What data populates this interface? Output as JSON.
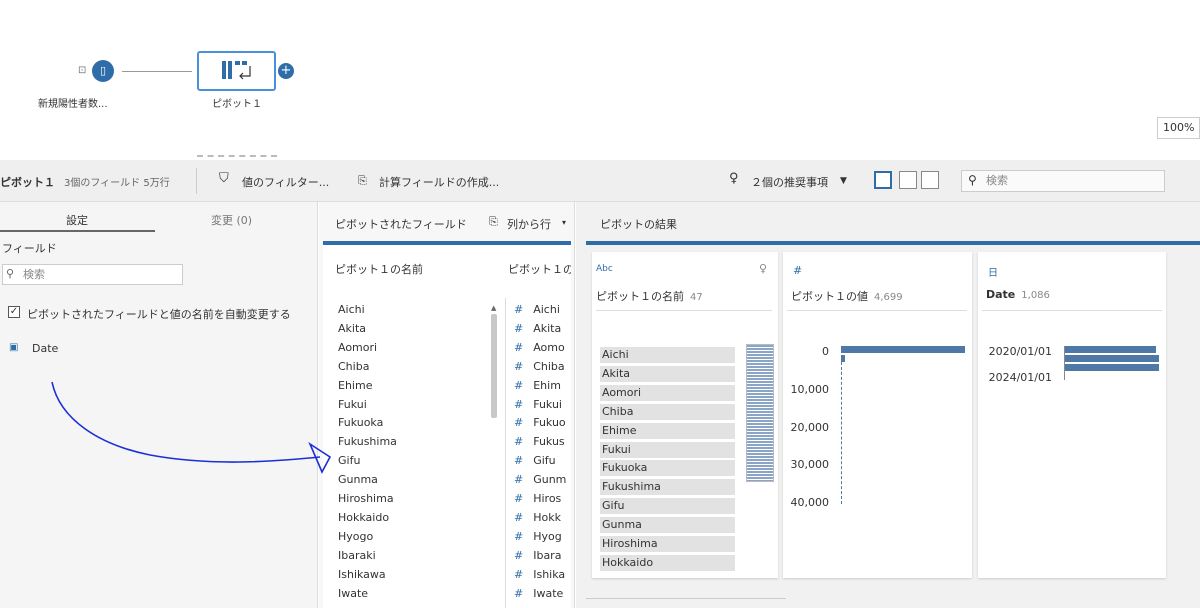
{
  "flow": {
    "source_label": "新規陽性者数...",
    "pivot_label": "ピボット１",
    "zoom": "100%"
  },
  "toolbar": {
    "step_name": "ピボット１",
    "step_meta": "3個のフィールド 5万行",
    "filter_label": "値のフィルター...",
    "calc_label": "計算フィールドの作成...",
    "recommend_label": "２個の推奨事項",
    "search_placeholder": "検索"
  },
  "left_panel": {
    "tab_settings": "設定",
    "tab_changes": "変更 (0)",
    "fields_heading": "フィールド",
    "search_placeholder": "検索",
    "auto_rename_label": "ピボットされたフィールドと値の名前を自動変更する",
    "field_date": "Date"
  },
  "middle_panel": {
    "header": "ピボットされたフィールド",
    "columns_to_rows": "列から行",
    "col1_header": "ピボット１の名前",
    "col2_header": "ピボット１の",
    "rows": [
      "Aichi",
      "Akita",
      "Aomori",
      "Chiba",
      "Ehime",
      "Fukui",
      "Fukuoka",
      "Fukushima",
      "Gifu",
      "Gunma",
      "Hiroshima",
      "Hokkaido",
      "Hyogo",
      "Ibaraki",
      "Ishikawa",
      "Iwate"
    ],
    "col2_rows": [
      "Aichi",
      "Akita",
      "Aomo",
      "Chiba",
      "Ehim",
      "Fukui",
      "Fukuo",
      "Fukus",
      "Gifu",
      "Gunm",
      "Hiros",
      "Hokk",
      "Hyog",
      "Ibara",
      "Ishika",
      "Iwate"
    ]
  },
  "results_panel": {
    "header": "ピボットの結果",
    "card_name": {
      "type": "Abc",
      "title": "ピボット１の名前",
      "count": "47",
      "values": [
        "Aichi",
        "Akita",
        "Aomori",
        "Chiba",
        "Ehime",
        "Fukui",
        "Fukuoka",
        "Fukushima",
        "Gifu",
        "Gunma",
        "Hiroshima",
        "Hokkaido"
      ]
    },
    "card_value": {
      "type": "#",
      "title": "ピボット１の値",
      "count": "4,699",
      "ticks": [
        "0",
        "10,000",
        "20,000",
        "30,000",
        "40,000"
      ]
    },
    "card_date": {
      "type": "日",
      "title": "Date",
      "count": "1,086",
      "ticks": [
        "2020/01/01",
        "2024/01/01"
      ]
    }
  }
}
